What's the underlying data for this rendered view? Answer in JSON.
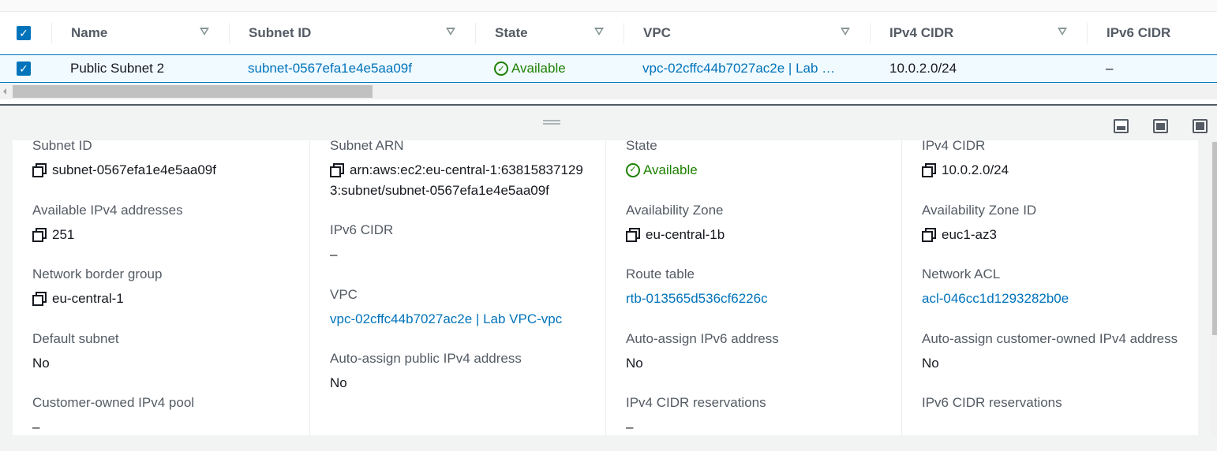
{
  "table": {
    "columns": [
      "Name",
      "Subnet ID",
      "State",
      "VPC",
      "IPv4 CIDR",
      "IPv6 CIDR"
    ],
    "row": {
      "selected": true,
      "name": "Public Subnet 2",
      "subnet_id": "subnet-0567efa1e4e5aa09f",
      "state": "Available",
      "vpc": "vpc-02cffc44b7027ac2e | Lab …",
      "ipv4_cidr": "10.0.2.0/24",
      "ipv6_cidr": "–"
    }
  },
  "details": {
    "columns": [
      [
        {
          "label": "Subnet ID",
          "value": "subnet-0567efa1e4e5aa09f",
          "copy": true
        },
        {
          "label": "Available IPv4 addresses",
          "value": "251",
          "copy": true
        },
        {
          "label": "Network border group",
          "value": "eu-central-1",
          "copy": true
        },
        {
          "label": "Default subnet",
          "value": "No"
        },
        {
          "label": "Customer-owned IPv4 pool",
          "value": "–"
        }
      ],
      [
        {
          "label": "Subnet ARN",
          "value": "arn:aws:ec2:eu-central-1:638158371293:subnet/subnet-0567efa1e4e5aa09f",
          "copy": true
        },
        {
          "label": "IPv6 CIDR",
          "value": "–"
        },
        {
          "label": "VPC",
          "value": "vpc-02cffc44b7027ac2e | Lab VPC-vpc",
          "link": true
        },
        {
          "label": "Auto-assign public IPv4 address",
          "value": "No"
        }
      ],
      [
        {
          "label": "State",
          "value": "Available",
          "status": true
        },
        {
          "label": "Availability Zone",
          "value": "eu-central-1b",
          "copy": true
        },
        {
          "label": "Route table",
          "value": "rtb-013565d536cf6226c",
          "link": true
        },
        {
          "label": "Auto-assign IPv6 address",
          "value": "No"
        },
        {
          "label": "IPv4 CIDR reservations",
          "value": "–"
        }
      ],
      [
        {
          "label": "IPv4 CIDR",
          "value": "10.0.2.0/24",
          "copy": true
        },
        {
          "label": "Availability Zone ID",
          "value": "euc1-az3",
          "copy": true
        },
        {
          "label": "Network ACL",
          "value": "acl-046cc1d1293282b0e",
          "link": true
        },
        {
          "label": "Auto-assign customer-owned IPv4 address",
          "value": "No"
        },
        {
          "label": "IPv6 CIDR reservations",
          "value": ""
        }
      ]
    ]
  },
  "icons": {
    "checkbox": "checkmark",
    "filter": "triangle-down",
    "status": "check-circle",
    "copy": "copy-icon",
    "panel_views": [
      "panel-bottom-small",
      "panel-bottom-large",
      "panel-full"
    ]
  },
  "colors": {
    "link": "#0073bb",
    "success": "#1d8102",
    "selected_row": "#f1faff"
  }
}
